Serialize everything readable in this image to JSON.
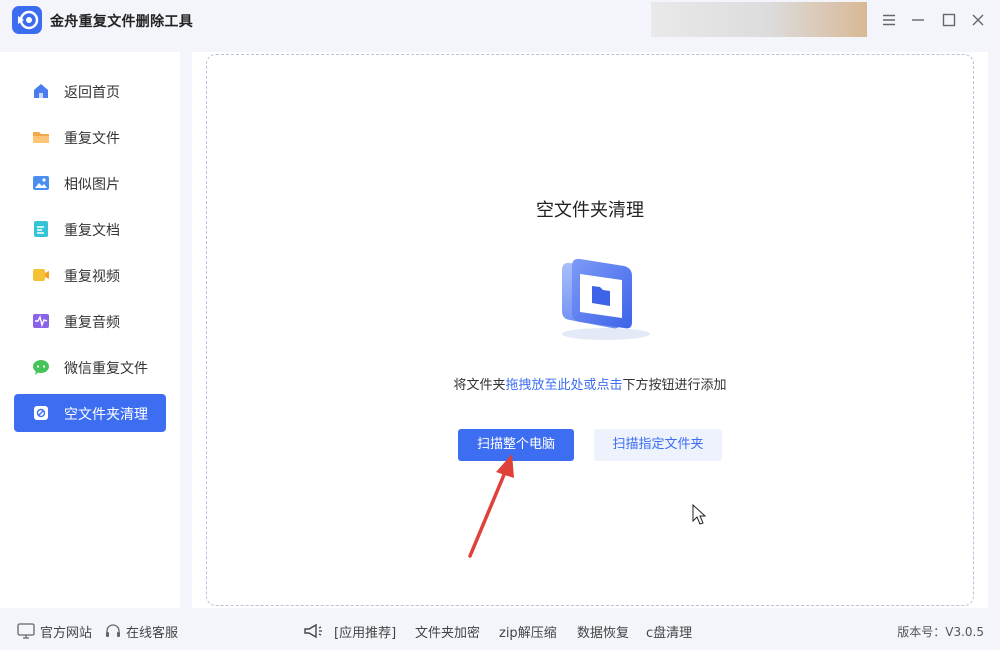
{
  "app": {
    "title": "金舟重复文件删除工具"
  },
  "window_controls": [
    {
      "name": "menu-icon"
    },
    {
      "name": "minimize-icon"
    },
    {
      "name": "maximize-icon"
    },
    {
      "name": "close-icon"
    }
  ],
  "sidebar": {
    "items": [
      {
        "label": "返回首页",
        "icon": "home-icon",
        "color": "#4a7cf0"
      },
      {
        "label": "重复文件",
        "icon": "folder-icon",
        "color": "#f5a84a"
      },
      {
        "label": "相似图片",
        "icon": "image-icon",
        "color": "#4a8ff0"
      },
      {
        "label": "重复文档",
        "icon": "document-icon",
        "color": "#35c3d6"
      },
      {
        "label": "重复视频",
        "icon": "video-icon",
        "color": "#f5c236"
      },
      {
        "label": "重复音频",
        "icon": "audio-icon",
        "color": "#8a63e8"
      },
      {
        "label": "微信重复文件",
        "icon": "wechat-icon",
        "color": "#46c35a"
      },
      {
        "label": "空文件夹清理",
        "icon": "empty-folder-icon",
        "color": "#ffffff",
        "active": true
      }
    ]
  },
  "main": {
    "title": "空文件夹清理",
    "hint_prefix": "将文件夹",
    "hint_link": "拖拽放至此处或点击",
    "hint_suffix": "下方按钮进行添加",
    "scan_all_label": "扫描整个电脑",
    "scan_folder_label": "扫描指定文件夹"
  },
  "footer": {
    "official_site": "官方网站",
    "online_service": "在线客服",
    "recommend": "[应用推荐]",
    "links": [
      "文件夹加密",
      "zip解压缩",
      "数据恢复",
      "c盘清理"
    ],
    "version": "版本号：V3.0.5"
  },
  "colors": {
    "accent": "#3d6ef2",
    "arrow": "#e0403a"
  }
}
